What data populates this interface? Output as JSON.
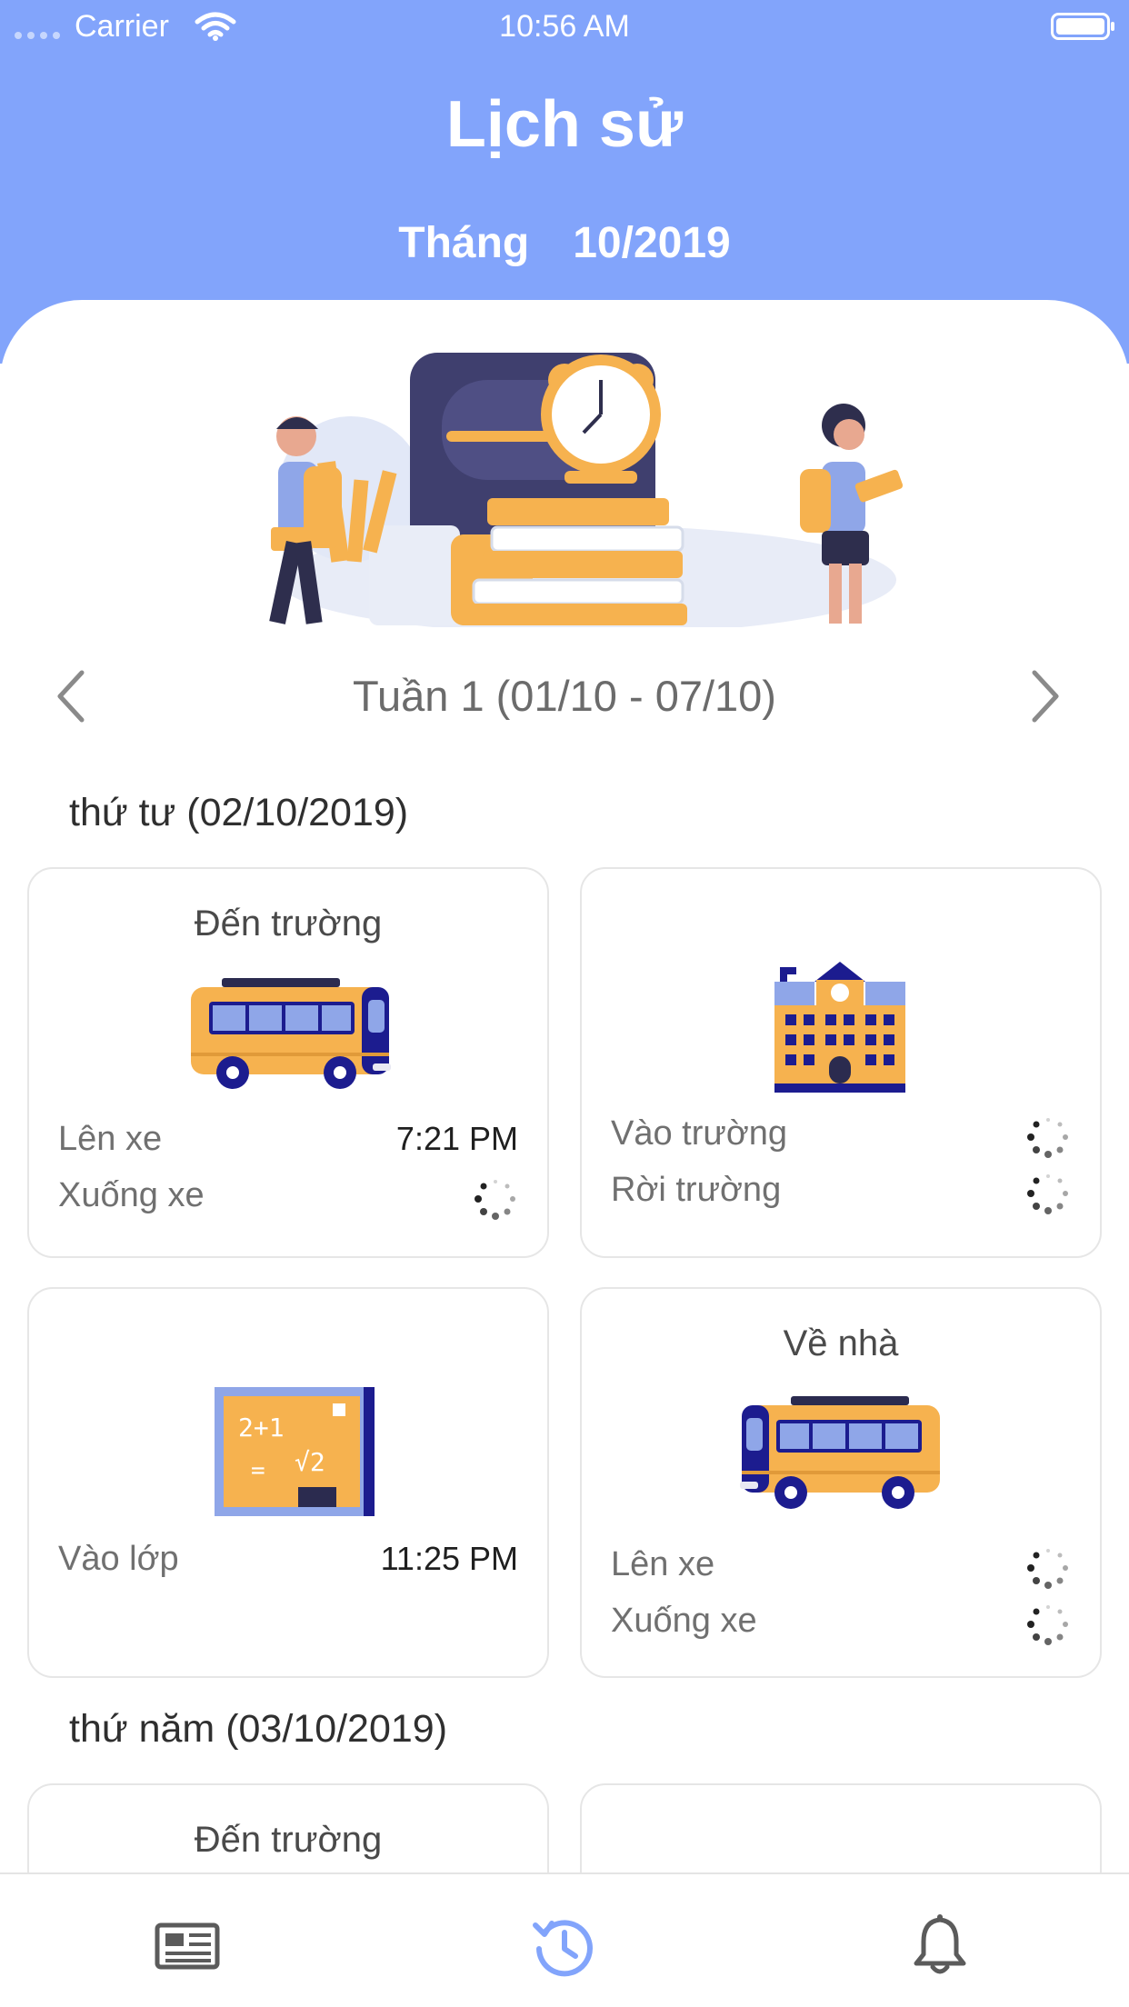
{
  "status_bar": {
    "carrier": "Carrier",
    "time": "10:56 AM"
  },
  "header": {
    "title": "Lịch sử",
    "month_label": "Tháng",
    "month_value": "10/2019"
  },
  "week": {
    "label": "Tuần 1 (01/10 - 07/10)"
  },
  "days": [
    {
      "header": "thứ tư (02/10/2019)",
      "cards": [
        {
          "title": "Đến trường",
          "icon": "bus-icon",
          "rows": [
            {
              "label": "Lên xe",
              "value": "7:21 PM"
            },
            {
              "label": "Xuống xe",
              "value": ""
            }
          ]
        },
        {
          "title": "",
          "icon": "school-building-icon",
          "rows": [
            {
              "label": "Vào trường",
              "value": ""
            },
            {
              "label": "Rời trường",
              "value": ""
            }
          ]
        },
        {
          "title": "",
          "icon": "chalkboard-icon",
          "rows": [
            {
              "label": "Vào lớp",
              "value": "11:25 PM"
            }
          ]
        },
        {
          "title": "Về nhà",
          "icon": "bus-icon",
          "rows": [
            {
              "label": "Lên xe",
              "value": ""
            },
            {
              "label": "Xuống xe",
              "value": ""
            }
          ]
        }
      ]
    },
    {
      "header": "thứ năm (03/10/2019)",
      "cards": [
        {
          "title": "Đến trường"
        },
        {
          "title": ""
        }
      ]
    }
  ],
  "tabbar": {
    "tabs": [
      {
        "icon": "news-icon",
        "active": false
      },
      {
        "icon": "history-icon",
        "active": true
      },
      {
        "icon": "bell-icon",
        "active": false
      }
    ]
  },
  "colors": {
    "header": "#82a4fb",
    "accent": "#82a4fb",
    "bus": "#f6b24f",
    "navy": "#1c1c8f"
  }
}
